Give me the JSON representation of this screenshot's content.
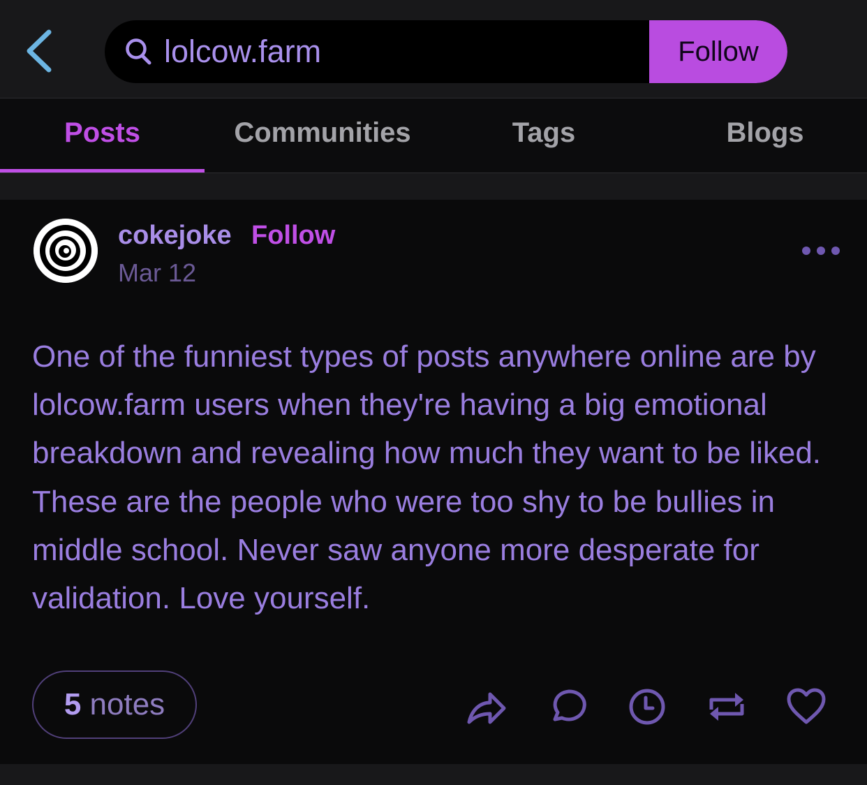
{
  "header": {
    "search_query": "lolcow.farm",
    "follow_label": "Follow",
    "icons": {
      "back": "back-chevron-icon",
      "search": "search-icon"
    },
    "colors": {
      "accent": "#b94ce0",
      "link_text": "#a990ec",
      "back_icon": "#6cb5e3"
    }
  },
  "tabs": [
    {
      "label": "Posts",
      "active": true
    },
    {
      "label": "Communities",
      "active": false
    },
    {
      "label": "Tags",
      "active": false
    },
    {
      "label": "Blogs",
      "active": false
    }
  ],
  "post": {
    "author": "cokejoke",
    "follow_label": "Follow",
    "date": "Mar 12",
    "avatar_icon": "spiral-avatar",
    "body": "One of the funniest types of posts anywhere online are by lolcow.farm users when they're having a big emotional breakdown and revealing how much they want to be liked. These are the people who were too shy to be bullies in middle school. Never saw anyone more desperate for validation. Love yourself.",
    "notes_count": "5",
    "notes_label": "notes",
    "actions": [
      "share-icon",
      "reply-icon",
      "clock-icon",
      "reblog-icon",
      "heart-icon"
    ],
    "colors": {
      "text": "#9a7ee0",
      "icons": "#6f58b0"
    }
  }
}
